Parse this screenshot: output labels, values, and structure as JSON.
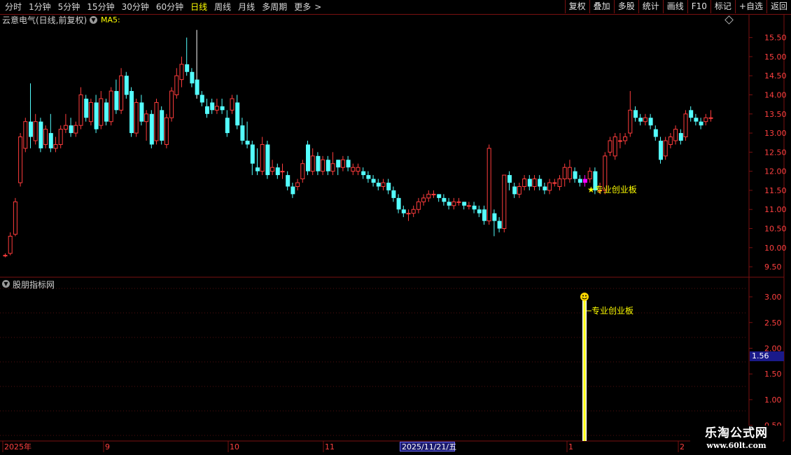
{
  "toolbar": {
    "periods": [
      "分时",
      "1分钟",
      "5分钟",
      "15分钟",
      "30分钟",
      "60分钟",
      "日线",
      "周线",
      "月线",
      "多周期",
      "更多"
    ],
    "active_period": "日线",
    "more_arrow": ">",
    "right_buttons": [
      "复权",
      "叠加",
      "多股",
      "统计",
      "画线",
      "F10",
      "标记",
      "+自选",
      "返回"
    ]
  },
  "main_chart": {
    "stock_title": "云意电气(日线,前复权)",
    "ma_label": "MA5:",
    "annotation": "★专业创业板",
    "price_axis": [
      "15.50",
      "15.00",
      "14.50",
      "14.00",
      "13.50",
      "13.00",
      "12.50",
      "12.00",
      "11.50",
      "11.00",
      "10.50",
      "10.00",
      "9.50"
    ]
  },
  "sub_chart": {
    "title": "股朋指标网",
    "signal_label": "专业创业板",
    "axis": [
      "3.00",
      "2.50",
      "2.00",
      "1.50",
      "1.00",
      "0.50"
    ],
    "cursor_value": "1.56"
  },
  "date_axis": {
    "labels": [
      "2025年",
      "9",
      "10",
      "11",
      "1",
      "2"
    ],
    "selected_date": "2025/11/21/五"
  },
  "watermark": {
    "line1": "乐淘公式网",
    "line2": "www.60lt.com"
  },
  "colors": {
    "up": "#ff3c3c",
    "down": "#54ffff",
    "grid": "#7a1010",
    "highlight": "#ff00ff",
    "signal": "#ffff00"
  },
  "chart_data": {
    "type": "candlestick",
    "ylim": [
      9.3,
      15.75
    ],
    "candles": [
      [
        9.8,
        9.8,
        9.85,
        9.75
      ],
      [
        9.85,
        10.3,
        10.4,
        9.8
      ],
      [
        10.35,
        11.2,
        11.3,
        10.3
      ],
      [
        11.7,
        12.9,
        13.0,
        11.6
      ],
      [
        12.6,
        13.3,
        13.4,
        12.5
      ],
      [
        13.3,
        12.9,
        14.3,
        12.6
      ],
      [
        12.8,
        13.3,
        13.5,
        12.7
      ],
      [
        13.3,
        12.6,
        13.4,
        12.5
      ],
      [
        12.7,
        13.1,
        13.2,
        12.6
      ],
      [
        13.0,
        12.6,
        13.5,
        12.5
      ],
      [
        12.6,
        12.7,
        12.9,
        12.5
      ],
      [
        12.7,
        13.1,
        13.2,
        12.6
      ],
      [
        13.1,
        13.2,
        13.5,
        13.0
      ],
      [
        13.2,
        13.0,
        13.4,
        12.9
      ],
      [
        13.0,
        13.2,
        13.3,
        12.9
      ],
      [
        13.2,
        14.0,
        14.2,
        13.1
      ],
      [
        13.9,
        13.4,
        14.0,
        13.3
      ],
      [
        13.3,
        13.8,
        13.9,
        13.2
      ],
      [
        13.8,
        13.1,
        14.0,
        13.0
      ],
      [
        13.2,
        13.9,
        14.1,
        13.1
      ],
      [
        13.8,
        13.3,
        13.9,
        13.2
      ],
      [
        13.3,
        14.1,
        14.2,
        13.2
      ],
      [
        14.1,
        13.6,
        14.4,
        13.5
      ],
      [
        13.6,
        14.5,
        14.7,
        13.5
      ],
      [
        14.5,
        14.0,
        14.6,
        13.9
      ],
      [
        14.1,
        13.0,
        14.2,
        12.9
      ],
      [
        13.0,
        13.8,
        13.9,
        12.9
      ],
      [
        13.8,
        13.3,
        14.0,
        13.2
      ],
      [
        13.3,
        13.5,
        13.6,
        12.8
      ],
      [
        13.5,
        12.7,
        13.6,
        12.6
      ],
      [
        12.8,
        13.8,
        13.9,
        12.7
      ],
      [
        13.6,
        12.8,
        13.7,
        12.7
      ],
      [
        12.7,
        13.4,
        13.5,
        12.6
      ],
      [
        13.4,
        14.1,
        14.2,
        13.3
      ],
      [
        14.0,
        14.5,
        14.7,
        13.9
      ],
      [
        14.4,
        14.8,
        15.0,
        14.2
      ],
      [
        14.8,
        14.6,
        15.5,
        14.5
      ],
      [
        14.6,
        14.3,
        14.7,
        14.2
      ],
      [
        14.4,
        14.0,
        15.7,
        13.9
      ],
      [
        14.0,
        13.8,
        14.1,
        13.7
      ],
      [
        13.7,
        13.5,
        13.9,
        13.4
      ],
      [
        13.8,
        13.6,
        13.9,
        13.5
      ],
      [
        13.6,
        13.7,
        13.9,
        13.5
      ],
      [
        13.7,
        13.6,
        13.9,
        13.5
      ],
      [
        13.4,
        13.0,
        13.6,
        12.9
      ],
      [
        13.6,
        13.9,
        14.0,
        13.5
      ],
      [
        13.8,
        13.2,
        14.0,
        13.1
      ],
      [
        13.2,
        12.8,
        13.4,
        12.7
      ],
      [
        12.8,
        12.7,
        13.3,
        12.6
      ],
      [
        12.7,
        12.2,
        12.8,
        11.9
      ],
      [
        12.1,
        12.0,
        12.6,
        11.9
      ],
      [
        12.0,
        12.7,
        12.9,
        11.9
      ],
      [
        12.7,
        11.9,
        12.8,
        11.8
      ],
      [
        12.0,
        12.1,
        12.3,
        11.9
      ],
      [
        12.1,
        11.9,
        12.2,
        11.8
      ],
      [
        12.0,
        12.0,
        12.2,
        11.8
      ],
      [
        11.9,
        11.6,
        12.0,
        11.5
      ],
      [
        11.6,
        11.4,
        11.7,
        11.3
      ],
      [
        11.6,
        11.7,
        11.8,
        11.5
      ],
      [
        11.8,
        12.2,
        12.3,
        11.7
      ],
      [
        12.7,
        12.0,
        12.8,
        11.9
      ],
      [
        12.0,
        12.4,
        12.6,
        11.9
      ],
      [
        12.4,
        12.0,
        12.5,
        11.9
      ],
      [
        12.0,
        12.3,
        12.4,
        11.9
      ],
      [
        12.3,
        12.0,
        12.4,
        11.9
      ],
      [
        12.0,
        12.2,
        12.5,
        11.9
      ],
      [
        12.3,
        12.1,
        12.3,
        11.9
      ],
      [
        12.1,
        12.3,
        12.4,
        12.0
      ],
      [
        12.3,
        12.1,
        12.4,
        12.0
      ],
      [
        12.0,
        12.1,
        12.2,
        11.9
      ],
      [
        12.0,
        12.1,
        12.2,
        11.9
      ],
      [
        12.0,
        11.9,
        12.1,
        11.8
      ],
      [
        11.9,
        11.8,
        12.0,
        11.7
      ],
      [
        11.8,
        11.7,
        11.9,
        11.6
      ],
      [
        11.7,
        11.6,
        11.8,
        11.5
      ],
      [
        11.6,
        11.7,
        11.8,
        11.5
      ],
      [
        11.7,
        11.5,
        11.8,
        11.4
      ],
      [
        11.5,
        11.3,
        11.6,
        11.2
      ],
      [
        11.3,
        11.0,
        11.4,
        10.9
      ],
      [
        11.0,
        10.9,
        11.1,
        10.8
      ],
      [
        10.9,
        10.9,
        11.0,
        10.7
      ],
      [
        10.9,
        11.0,
        11.1,
        10.8
      ],
      [
        11.0,
        11.2,
        11.3,
        10.9
      ],
      [
        11.2,
        11.3,
        11.4,
        11.1
      ],
      [
        11.3,
        11.4,
        11.5,
        11.2
      ],
      [
        11.4,
        11.4,
        11.5,
        11.3
      ],
      [
        11.4,
        11.3,
        11.4,
        11.2
      ],
      [
        11.3,
        11.2,
        11.4,
        11.1
      ],
      [
        11.2,
        11.1,
        11.3,
        11.0
      ],
      [
        11.1,
        11.2,
        11.3,
        11.0
      ],
      [
        11.2,
        11.2,
        11.3,
        11.1
      ],
      [
        11.2,
        11.1,
        11.2,
        11.0
      ],
      [
        11.1,
        11.1,
        11.2,
        11.0
      ],
      [
        11.1,
        11.0,
        11.2,
        10.9
      ],
      [
        11.0,
        10.9,
        11.1,
        10.8
      ],
      [
        11.0,
        10.7,
        11.1,
        10.6
      ],
      [
        10.7,
        12.6,
        12.7,
        10.6
      ],
      [
        10.9,
        10.7,
        11.0,
        10.3
      ],
      [
        10.7,
        10.5,
        10.8,
        10.4
      ],
      [
        10.5,
        11.9,
        11.9,
        10.4
      ],
      [
        11.9,
        11.7,
        12.0,
        11.5
      ],
      [
        11.6,
        11.4,
        11.7,
        11.3
      ],
      [
        11.4,
        11.6,
        11.7,
        11.3
      ],
      [
        11.6,
        11.8,
        11.9,
        11.5
      ],
      [
        11.8,
        11.6,
        11.9,
        11.5
      ],
      [
        11.6,
        11.8,
        11.9,
        11.5
      ],
      [
        11.8,
        11.6,
        11.9,
        11.5
      ],
      [
        11.6,
        11.5,
        11.7,
        11.4
      ],
      [
        11.5,
        11.7,
        11.8,
        11.4
      ],
      [
        11.7,
        11.7,
        11.8,
        11.6
      ],
      [
        11.6,
        11.8,
        11.9,
        11.5
      ],
      [
        11.8,
        12.1,
        12.2,
        11.6
      ],
      [
        11.8,
        12.1,
        12.3,
        11.7
      ],
      [
        12.0,
        11.8,
        12.1,
        11.7
      ],
      [
        11.8,
        11.7,
        11.9,
        11.6
      ],
      [
        11.7,
        11.8,
        11.9,
        11.6
      ],
      [
        11.8,
        12.0,
        12.1,
        11.7
      ],
      [
        12.0,
        11.5,
        12.1,
        11.4
      ],
      [
        11.5,
        11.5,
        11.7,
        11.4
      ],
      [
        11.5,
        12.4,
        12.5,
        11.4
      ],
      [
        12.5,
        12.8,
        12.9,
        12.4
      ],
      [
        12.4,
        12.9,
        13.0,
        12.3
      ],
      [
        12.8,
        12.8,
        13.0,
        12.6
      ],
      [
        12.8,
        12.9,
        13.0,
        12.7
      ],
      [
        13.0,
        13.6,
        14.1,
        12.9
      ],
      [
        13.6,
        13.4,
        13.7,
        13.3
      ],
      [
        13.4,
        13.3,
        13.5,
        13.2
      ],
      [
        13.3,
        13.4,
        13.5,
        13.2
      ],
      [
        13.4,
        13.2,
        13.5,
        13.1
      ],
      [
        13.1,
        12.9,
        13.2,
        12.8
      ],
      [
        12.8,
        12.3,
        12.9,
        12.2
      ],
      [
        12.4,
        12.8,
        12.9,
        12.3
      ],
      [
        12.7,
        12.9,
        13.0,
        12.6
      ],
      [
        12.8,
        13.1,
        13.2,
        12.7
      ],
      [
        13.0,
        12.8,
        13.1,
        12.7
      ],
      [
        12.9,
        13.5,
        13.6,
        12.8
      ],
      [
        13.6,
        13.4,
        13.7,
        13.3
      ],
      [
        13.4,
        13.3,
        13.5,
        13.2
      ],
      [
        13.3,
        13.2,
        13.4,
        13.1
      ],
      [
        13.3,
        13.4,
        13.5,
        13.2
      ],
      [
        13.4,
        13.4,
        13.6,
        13.3
      ]
    ],
    "signal": {
      "index": 115,
      "value": 3.0
    }
  }
}
